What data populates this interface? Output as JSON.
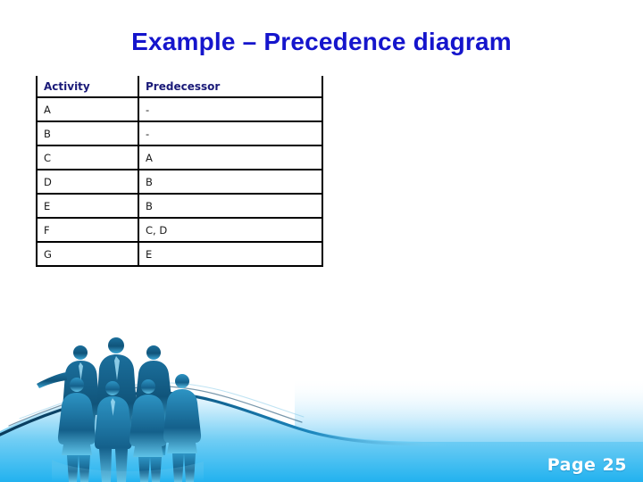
{
  "slide": {
    "title": "Example – Precedence diagram",
    "title_color": "#1515cc",
    "background_color": "#ffffff",
    "page_label": "Page 25"
  },
  "table": {
    "name": "precedence-table",
    "headers": [
      "Activity",
      "Predecessor"
    ],
    "header_text_color": "#1a1a78",
    "border_color": "#000000",
    "rows": [
      {
        "activity": "A",
        "predecessor": "-"
      },
      {
        "activity": "B",
        "predecessor": "-"
      },
      {
        "activity": "C",
        "predecessor": "A"
      },
      {
        "activity": "D",
        "predecessor": "B"
      },
      {
        "activity": "E",
        "predecessor": "B"
      },
      {
        "activity": "F",
        "predecessor": "C, D"
      },
      {
        "activity": "G",
        "predecessor": "E"
      }
    ]
  },
  "decoration": {
    "wave_icon": "blue-wave-graphic",
    "people_icon": "business-people-silhouette-group",
    "wave_color_light": "#2fb8f0",
    "wave_color_deep": "#0f5f8f",
    "people_color": "#1a6f99"
  }
}
